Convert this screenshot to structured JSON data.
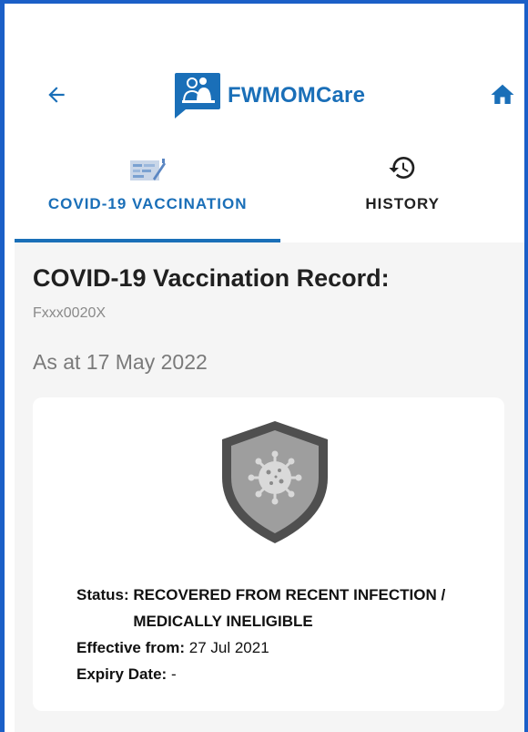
{
  "header": {
    "brand_name": "FWMOMCare",
    "back_icon": "arrow-left-icon",
    "home_icon": "home-icon"
  },
  "tabs": [
    {
      "label": "COVID-19 VACCINATION",
      "icon": "vaccination-record-icon",
      "active": true
    },
    {
      "label": "HISTORY",
      "icon": "history-icon",
      "active": false
    }
  ],
  "record": {
    "title": "COVID-19 Vaccination Record:",
    "fin": "Fxxx0020X",
    "as_at": "As at 17 May 2022",
    "status_label": "Status: ",
    "status_value": "RECOVERED FROM RECENT INFECTION / MEDICALLY INELIGIBLE",
    "effective_label": "Effective from: ",
    "effective_value": "27 Jul 2021",
    "expiry_label": "Expiry Date: ",
    "expiry_value": "-"
  },
  "colors": {
    "accent": "#1a6fb8",
    "frame_border": "#1b5fc7",
    "background": "#f5f5f5"
  }
}
